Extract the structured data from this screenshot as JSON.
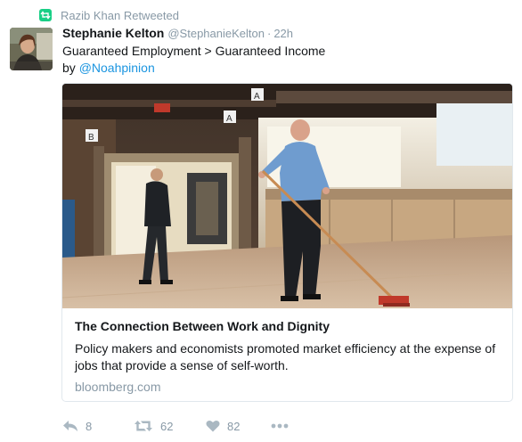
{
  "retweet_context": {
    "icon": "retweet-icon",
    "text": "Razib Khan Retweeted",
    "color": "#19cf86"
  },
  "tweet": {
    "fullname": "Stephanie Kelton",
    "username": "@StephanieKelton",
    "separator": "·",
    "time": "22h",
    "text_line1": "Guaranteed Employment > Guaranteed Income",
    "text_line2_prefix": "by ",
    "mention": "@Noahpinion"
  },
  "card": {
    "image_icon": "photo-janitor-sweeping-floor",
    "title": "The Connection Between Work and Dignity",
    "description": "Policy makers and economists promoted market efficiency at the expense of jobs that provide a sense of self-worth.",
    "domain": "bloomberg.com"
  },
  "actions": {
    "reply": {
      "icon": "reply-icon",
      "count": "8"
    },
    "retweet": {
      "icon": "retweet-icon",
      "count": "62"
    },
    "like": {
      "icon": "heart-icon",
      "count": "82"
    },
    "more": {
      "icon": "more-dots-icon"
    }
  },
  "colors": {
    "link": "#1b95e0",
    "muted": "#8899a6",
    "action_icon": "#aab8c2",
    "retweet_green": "#19cf86"
  }
}
